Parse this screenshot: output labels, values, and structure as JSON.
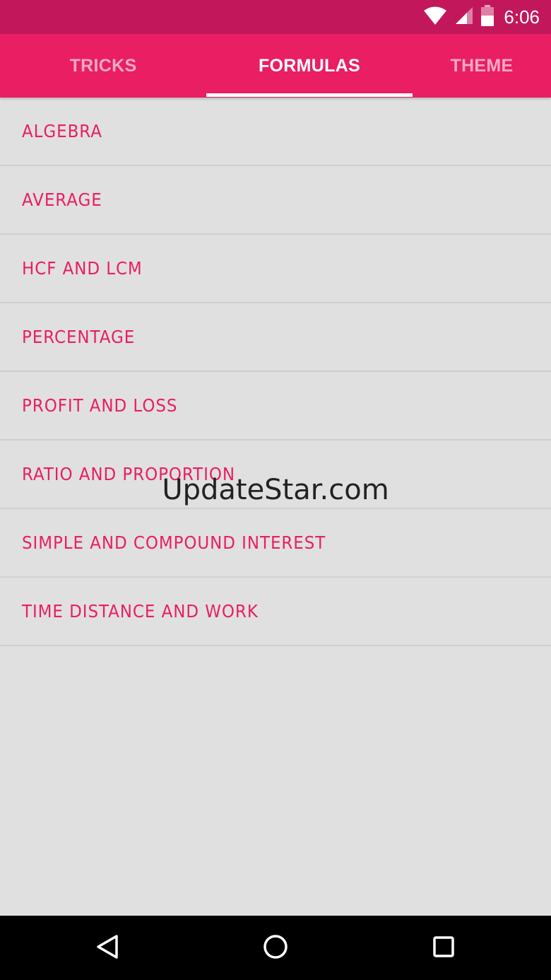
{
  "status_bar": {
    "time": "6:06",
    "icons": [
      "wifi-icon",
      "signal-icon",
      "battery-icon"
    ]
  },
  "tabs": [
    {
      "label": "TRICKS",
      "active": false
    },
    {
      "label": "FORMULAS",
      "active": true
    },
    {
      "label": "THEME",
      "active": false
    }
  ],
  "list": {
    "items": [
      {
        "label": "ALGEBRA"
      },
      {
        "label": "AVERAGE"
      },
      {
        "label": "HCF AND LCM"
      },
      {
        "label": "PERCENTAGE"
      },
      {
        "label": "PROFIT AND LOSS"
      },
      {
        "label": "RATIO AND PROPORTION"
      },
      {
        "label": "SIMPLE AND COMPOUND INTEREST"
      },
      {
        "label": "TIME DISTANCE AND WORK"
      }
    ]
  },
  "watermark": "UpdateStar.com",
  "nav_bar": {
    "icons": [
      "back-icon",
      "home-icon",
      "recents-icon"
    ]
  },
  "colors": {
    "status_bar": "#c2185b",
    "accent": "#e91e63",
    "background": "#e0e0e0",
    "divider": "#cfcfcf",
    "nav_bar": "#000000"
  }
}
